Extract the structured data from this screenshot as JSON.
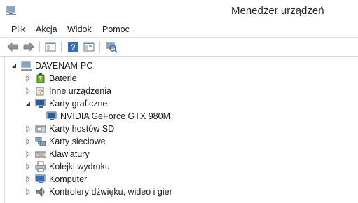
{
  "window": {
    "title": "Menedżer urządzeń"
  },
  "menubar": {
    "items": [
      "Plik",
      "Akcja",
      "Widok",
      "Pomoc"
    ]
  },
  "toolbar": {
    "buttons": [
      "back-icon",
      "forward-icon",
      "show-hide-console-tree-icon",
      "help-icon",
      "properties-icon",
      "scan-hardware-icon"
    ]
  },
  "tree": {
    "root": {
      "label": "DAVENAM-PC",
      "expanded": true
    },
    "items": [
      {
        "label": "Baterie",
        "expanded": false,
        "icon": "battery-icon"
      },
      {
        "label": "Inne urządzenia",
        "expanded": false,
        "icon": "unknown-device-icon"
      },
      {
        "label": "Karty graficzne",
        "expanded": true,
        "icon": "display-adapter-icon"
      },
      {
        "label": "NVIDIA GeForce GTX 980M",
        "child": true,
        "icon": "display-adapter-icon"
      },
      {
        "label": "Karty hostów SD",
        "expanded": false,
        "icon": "sd-host-icon"
      },
      {
        "label": "Karty sieciowe",
        "expanded": false,
        "icon": "network-adapter-icon"
      },
      {
        "label": "Klawiatury",
        "expanded": false,
        "icon": "keyboard-icon"
      },
      {
        "label": "Kolejki wydruku",
        "expanded": false,
        "icon": "printer-icon"
      },
      {
        "label": "Komputer",
        "expanded": false,
        "icon": "computer-icon"
      },
      {
        "label": "Kontrolery dźwięku, wideo i gier",
        "expanded": false,
        "icon": "sound-icon"
      }
    ]
  }
}
